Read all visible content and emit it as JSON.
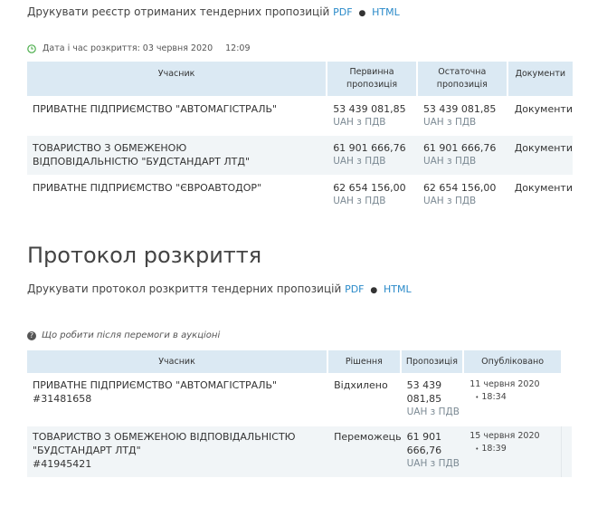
{
  "register": {
    "print_text": "Друкувати реєстр отриманих тендерних пропозицій",
    "pdf": "PDF",
    "separator": "●",
    "html": "HTML",
    "opening_label": "Дата і час розкриття: 03 червня 2020",
    "opening_time": "12:09",
    "headers": {
      "participant": "Учасник",
      "initial": "Первинна пропозиція",
      "final": "Остаточна пропозиція",
      "documents": "Документи"
    },
    "rows": [
      {
        "name": "ПРИВАТНЕ ПІДПРИЄМСТВО \"АВТОМАГІСТРАЛЬ\"",
        "initial": "53 439 081,85",
        "initial_vat": "UAH з ПДВ",
        "final": "53 439 081,85",
        "final_vat": "UAH з ПДВ",
        "documents": "Документи"
      },
      {
        "name": "ТОВАРИСТВО З ОБМЕЖЕНОЮ ВІДПОВІДАЛЬНІСТЮ \"БУДСТАНДАРТ ЛТД\"",
        "initial": "61 901 666,76",
        "initial_vat": "UAH з ПДВ",
        "final": "61 901 666,76",
        "final_vat": "UAH з ПДВ",
        "documents": "Документи"
      },
      {
        "name": "ПРИВАТНЕ ПІДПРИЄМСТВО \"ЄВРОАВТОДОР\"",
        "initial": "62 654 156,00",
        "initial_vat": "UAH з ПДВ",
        "final": "62 654 156,00",
        "final_vat": "UAH з ПДВ",
        "documents": "Документи"
      }
    ]
  },
  "protocol": {
    "title": "Протокол розкриття",
    "print_text": "Друкувати протокол розкриття тендерних пропозицій",
    "pdf": "PDF",
    "separator": "●",
    "html": "HTML",
    "help_text": "Що робити після перемоги в аукціоні",
    "headers": {
      "participant": "Учасник",
      "decision": "Рішення",
      "proposal": "Пропозиція",
      "published": "Опубліковано"
    },
    "rows": [
      {
        "name": "ПРИВАТНЕ ПІДПРИЄМСТВО \"АВТОМАГІСТРАЛЬ\"",
        "code": "#31481658",
        "decision": "Відхилено",
        "proposal_l1": "53 439",
        "proposal_l2": "081,85",
        "proposal_vat": "UAH з ПДВ",
        "date": "11 червня 2020",
        "time": "18:34"
      },
      {
        "name": "ТОВАРИСТВО З ОБМЕЖЕНОЮ ВІДПОВІДАЛЬНІСТЮ \"БУДСТАНДАРТ ЛТД\"",
        "code": "#41945421",
        "decision": "Переможець",
        "proposal_l1": "61 901",
        "proposal_l2": "666,76",
        "proposal_vat": "UAH з ПДВ",
        "date": "15 червня 2020",
        "time": "18:39"
      }
    ]
  }
}
